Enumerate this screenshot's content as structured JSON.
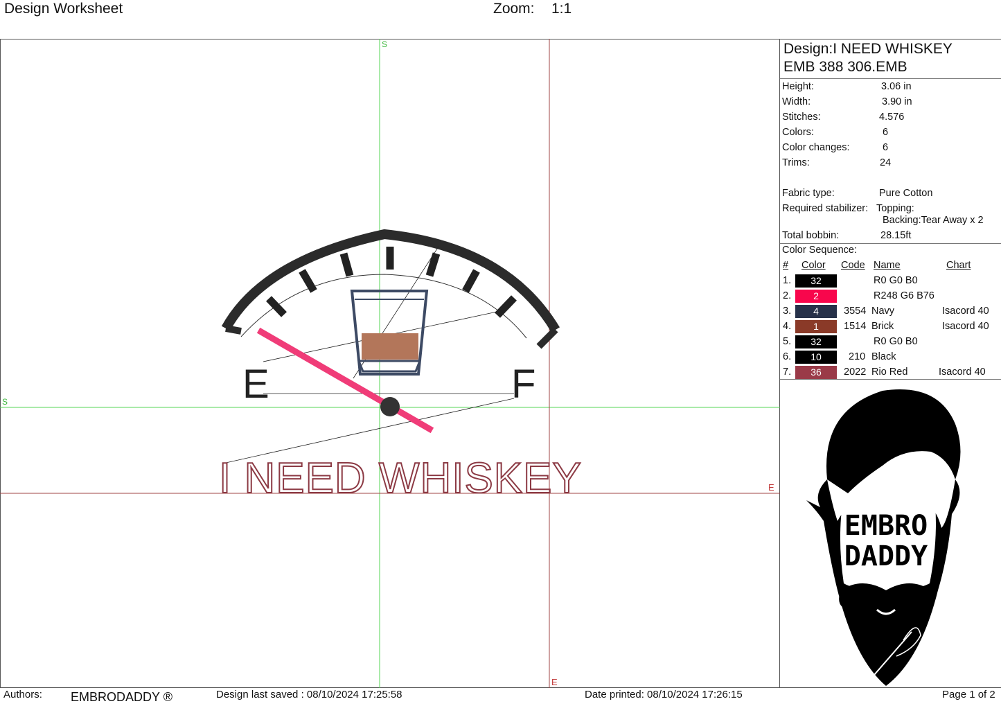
{
  "header": {
    "title": "Design Worksheet",
    "zoom_label": "Zoom:",
    "zoom_value": "1:1"
  },
  "canvas": {
    "markers": {
      "start_top": "S",
      "start_left": "S",
      "end_right": "E",
      "end_bottom": "E"
    },
    "design": {
      "gauge_left_letter": "E",
      "gauge_right_letter": "F",
      "caption": "I NEED WHISKEY",
      "colors": {
        "frame": "#2b2b2b",
        "needle": "#f03c78",
        "glass": "#3d4a64",
        "whiskey": "#b3765a",
        "caption": "#8c3a44",
        "guide_green": "#56d656",
        "guide_red": "#a24444"
      }
    }
  },
  "panel": {
    "design_name": "Design:I NEED WHISKEY",
    "design_file": "EMB 388 306.EMB",
    "info": [
      {
        "label": "Height:",
        "value": "3.06 in"
      },
      {
        "label": "Width:",
        "value": "3.90 in"
      },
      {
        "label": "Stitches:",
        "value": "4.576"
      },
      {
        "label": "Colors:",
        "value": "6"
      },
      {
        "label": "Color changes:",
        "value": "6"
      },
      {
        "label": "Trims:",
        "value": "24"
      }
    ],
    "fabric_label": "Fabric type:",
    "fabric_value": "Pure Cotton",
    "stabilizer_label": "Required stabilizer:",
    "topping_label": "Topping:",
    "backing_label": "Backing:Tear Away x 2",
    "bobbin_label": "Total bobbin:",
    "bobbin_value": "28.15ft",
    "color_sequence": {
      "title": "Color Sequence:",
      "headers": {
        "num": "#",
        "color": "Color",
        "code": "Code",
        "name": "Name",
        "chart": "Chart"
      },
      "rows": [
        {
          "num": "1.",
          "swatch": "32",
          "hex": "#000000",
          "code": "",
          "name": "R0 G0 B0",
          "chart": ""
        },
        {
          "num": "2.",
          "swatch": "2",
          "hex": "#f8064c",
          "code": "",
          "name": "R248 G6 B76",
          "chart": ""
        },
        {
          "num": "3.",
          "swatch": "4",
          "hex": "#27324a",
          "code": "3554",
          "name": "Navy",
          "chart": "Isacord 40"
        },
        {
          "num": "4.",
          "swatch": "1",
          "hex": "#8a3a28",
          "code": "1514",
          "name": "Brick",
          "chart": "Isacord 40"
        },
        {
          "num": "5.",
          "swatch": "32",
          "hex": "#000000",
          "code": "",
          "name": "R0 G0 B0",
          "chart": ""
        },
        {
          "num": "6.",
          "swatch": "10",
          "hex": "#000000",
          "code": "210",
          "name": "Black",
          "chart": ""
        },
        {
          "num": "7.",
          "swatch": "36",
          "hex": "#9a3a48",
          "code": "2022",
          "name": "Rio Red",
          "chart": "Isacord 40"
        }
      ]
    },
    "logo": {
      "line1": "EMBRO",
      "line2": "DADDY"
    }
  },
  "footer": {
    "authors_label": "Authors:",
    "brand": "EMBRODADDY ®",
    "saved": "Design last saved : 08/10/2024 17:25:58",
    "printed": "Date printed: 08/10/2024 17:26:15",
    "page": "Page 1 of 2"
  }
}
